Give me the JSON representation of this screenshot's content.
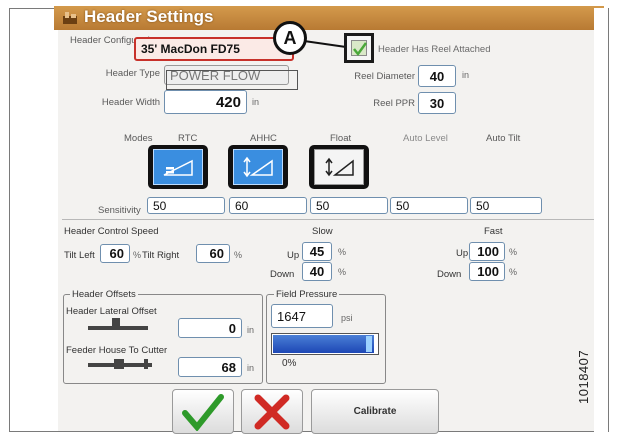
{
  "window": {
    "title": "Header Settings"
  },
  "header_config": {
    "label": "Header Configuration",
    "value": "35' MacDon FD75"
  },
  "reel_attached": {
    "label": "Header Has Reel Attached",
    "checked": true
  },
  "callout": {
    "letter": "A"
  },
  "header_type": {
    "label": "Header Type",
    "value": "POWER FLOW"
  },
  "reel_diameter": {
    "label": "Reel Diameter",
    "value": "40",
    "unit": "in"
  },
  "header_width": {
    "label": "Header Width",
    "value": "420",
    "unit": "in"
  },
  "reel_ppr": {
    "label": "Reel PPR",
    "value": "30"
  },
  "modes": {
    "label": "Modes",
    "items": [
      {
        "label": "RTC",
        "active": true,
        "icon": "rtc-icon",
        "sensitivity": "50"
      },
      {
        "label": "AHHC",
        "active": true,
        "icon": "ahhc-icon",
        "sensitivity": "60"
      },
      {
        "label": "Float",
        "active": false,
        "icon": "float-icon",
        "sensitivity": "50"
      },
      {
        "label": "Auto Level",
        "active": false,
        "icon": "",
        "sensitivity": "50"
      },
      {
        "label": "Auto Tilt",
        "active": false,
        "icon": "",
        "sensitivity": "50"
      }
    ]
  },
  "sensitivity": {
    "label": "Sensitivity"
  },
  "control_speed": {
    "label": "Header Control Speed",
    "tilt_left_label": "Tilt Left",
    "tilt_left": "60",
    "tilt_right_label": "Tilt Right",
    "tilt_right": "60",
    "pct": "%",
    "slow_label": "Slow",
    "fast_label": "Fast",
    "up_label": "Up",
    "down_label": "Down",
    "slow_up": "45",
    "slow_down": "40",
    "fast_up": "100",
    "fast_down": "100"
  },
  "header_offsets": {
    "label": "Header Offsets",
    "lateral_label": "Header Lateral Offset",
    "lateral_value": "0",
    "lateral_unit": "in",
    "feeder_label": "Feeder House To Cutter",
    "feeder_value": "68",
    "feeder_unit": "in"
  },
  "field_pressure": {
    "label": "Field Pressure",
    "value": "1647",
    "unit": "psi",
    "percent_label": "0%",
    "bar_fill_fraction": 0.97
  },
  "buttons": {
    "calibrate": "Calibrate"
  },
  "figure_number": "1018407",
  "colors": {
    "title_bar": "#c98a3f",
    "mode_active": "#3a8ee0",
    "accept": "#2e9a2a",
    "cancel": "#d02a24",
    "highlight": "#c7312a"
  }
}
